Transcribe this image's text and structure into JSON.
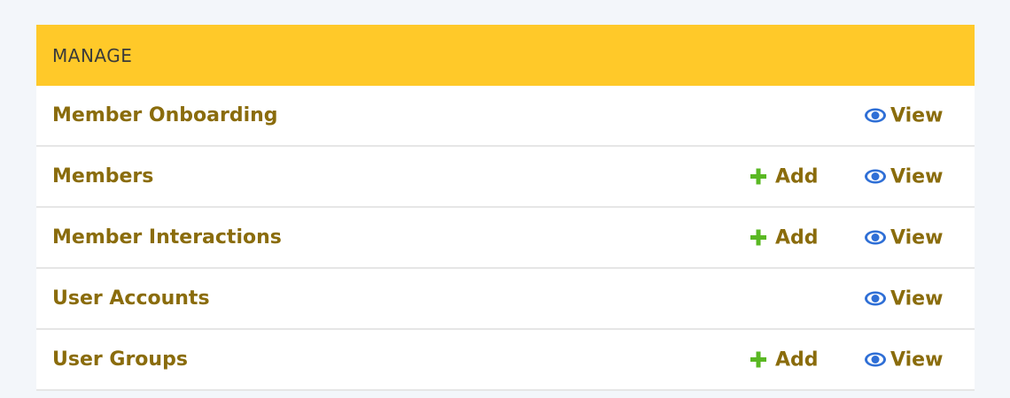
{
  "module": {
    "header": "MANAGE",
    "colors": {
      "header_bg": "#ffc929",
      "link": "#8a6c0c",
      "add_icon": "#5ab823",
      "view_icon": "#2f6fd6",
      "page_bg": "#f3f6fa"
    },
    "rows": [
      {
        "label": "Member Onboarding",
        "add": null,
        "view": "View"
      },
      {
        "label": "Members",
        "add": "Add",
        "view": "View"
      },
      {
        "label": "Member Interactions",
        "add": "Add",
        "view": "View"
      },
      {
        "label": "User Accounts",
        "add": null,
        "view": "View"
      },
      {
        "label": "User Groups",
        "add": "Add",
        "view": "View"
      }
    ]
  },
  "icons": {
    "add": "plus-icon",
    "view": "eye-icon"
  }
}
